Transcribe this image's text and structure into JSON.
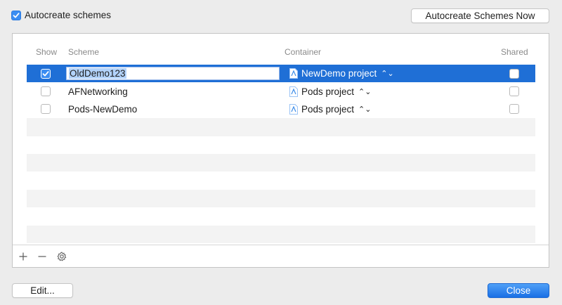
{
  "top": {
    "autocreate_label": "Autocreate schemes",
    "autocreate_checked": true,
    "autocreate_now_label": "Autocreate Schemes Now"
  },
  "table": {
    "headers": {
      "show": "Show",
      "scheme": "Scheme",
      "container": "Container",
      "shared": "Shared"
    },
    "rows": [
      {
        "show": true,
        "scheme": "OldDemo123",
        "container": "NewDemo project",
        "shared": false,
        "selected": true,
        "editing": true
      },
      {
        "show": false,
        "scheme": "AFNetworking",
        "container": "Pods project",
        "shared": false
      },
      {
        "show": false,
        "scheme": "Pods-NewDemo",
        "container": "Pods project",
        "shared": false
      }
    ],
    "empty_rows": 7
  },
  "toolbar": {
    "add_icon": "plus-icon",
    "remove_icon": "minus-icon",
    "action_icon": "gear-icon"
  },
  "footer": {
    "edit_label": "Edit...",
    "close_label": "Close"
  },
  "colors": {
    "accent": "#1f6fd6",
    "checkbox_on": "#3b8df2",
    "alt_row": "#f3f3f3"
  }
}
